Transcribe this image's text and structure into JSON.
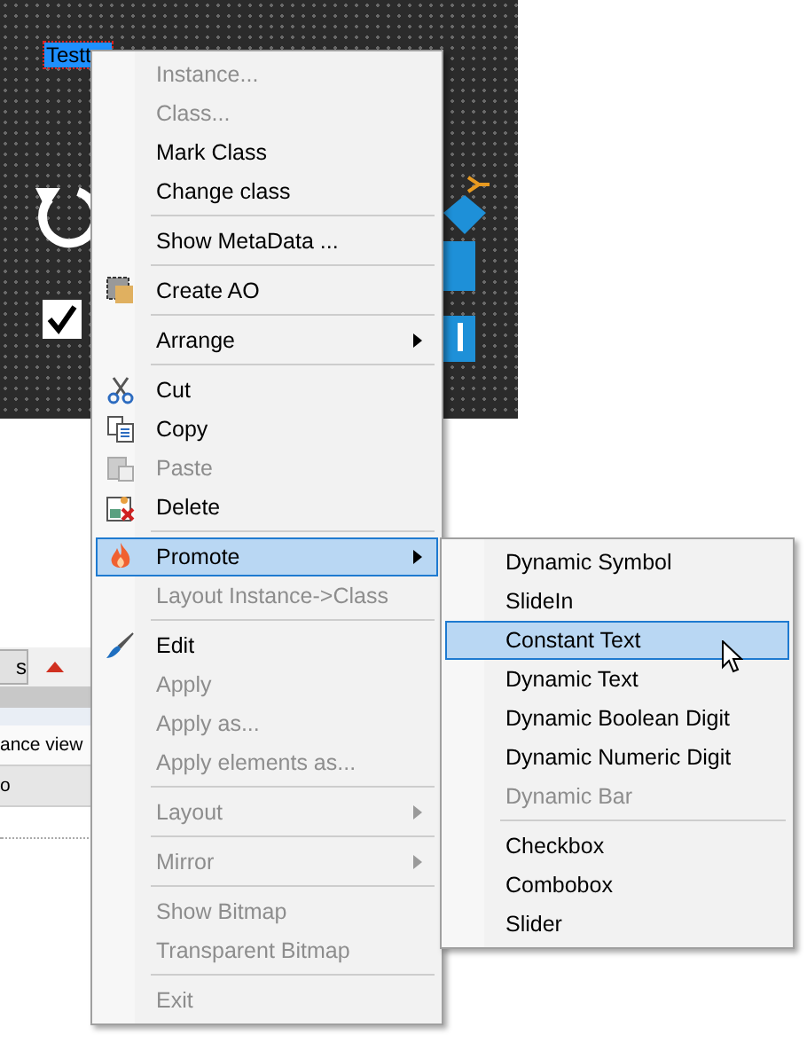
{
  "canvas": {
    "selected_label": "Testt"
  },
  "bottom_panel": {
    "toolbar_button": "s",
    "rows": [
      "ance view",
      "o"
    ]
  },
  "context_menu": {
    "items": [
      {
        "kind": "item",
        "label": "Instance...",
        "disabled": true,
        "submenu": false,
        "selected": false
      },
      {
        "kind": "item",
        "label": "Class...",
        "disabled": true,
        "submenu": false,
        "selected": false
      },
      {
        "kind": "item",
        "label": "Mark Class",
        "disabled": false,
        "submenu": false,
        "selected": false
      },
      {
        "kind": "item",
        "label": "Change class",
        "disabled": false,
        "submenu": false,
        "selected": false
      },
      {
        "kind": "separator"
      },
      {
        "kind": "item",
        "label": "Show MetaData ...",
        "disabled": false,
        "submenu": false,
        "selected": false
      },
      {
        "kind": "separator"
      },
      {
        "kind": "item",
        "label": "Create AO",
        "disabled": false,
        "submenu": false,
        "selected": false
      },
      {
        "kind": "separator"
      },
      {
        "kind": "item",
        "label": "Arrange",
        "disabled": false,
        "submenu": true,
        "selected": false
      },
      {
        "kind": "separator"
      },
      {
        "kind": "item",
        "label": "Cut",
        "disabled": false,
        "submenu": false,
        "selected": false
      },
      {
        "kind": "item",
        "label": "Copy",
        "disabled": false,
        "submenu": false,
        "selected": false
      },
      {
        "kind": "item",
        "label": "Paste",
        "disabled": true,
        "submenu": false,
        "selected": false
      },
      {
        "kind": "item",
        "label": "Delete",
        "disabled": false,
        "submenu": false,
        "selected": false
      },
      {
        "kind": "separator"
      },
      {
        "kind": "item",
        "label": "Promote",
        "disabled": false,
        "submenu": true,
        "selected": true
      },
      {
        "kind": "item",
        "label": "Layout Instance->Class",
        "disabled": true,
        "submenu": false,
        "selected": false
      },
      {
        "kind": "separator"
      },
      {
        "kind": "item",
        "label": "Edit",
        "disabled": false,
        "submenu": false,
        "selected": false
      },
      {
        "kind": "item",
        "label": "Apply",
        "disabled": true,
        "submenu": false,
        "selected": false
      },
      {
        "kind": "item",
        "label": "Apply as...",
        "disabled": true,
        "submenu": false,
        "selected": false
      },
      {
        "kind": "item",
        "label": "Apply elements as...",
        "disabled": true,
        "submenu": false,
        "selected": false
      },
      {
        "kind": "separator"
      },
      {
        "kind": "item",
        "label": "Layout",
        "disabled": true,
        "submenu": true,
        "selected": false
      },
      {
        "kind": "separator"
      },
      {
        "kind": "item",
        "label": "Mirror",
        "disabled": true,
        "submenu": true,
        "selected": false
      },
      {
        "kind": "separator"
      },
      {
        "kind": "item",
        "label": "Show Bitmap",
        "disabled": true,
        "submenu": false,
        "selected": false
      },
      {
        "kind": "item",
        "label": "Transparent Bitmap",
        "disabled": true,
        "submenu": false,
        "selected": false
      },
      {
        "kind": "separator"
      },
      {
        "kind": "item",
        "label": "Exit",
        "disabled": true,
        "submenu": false,
        "selected": false
      }
    ]
  },
  "submenu": {
    "items": [
      {
        "kind": "item",
        "label": "Dynamic Symbol",
        "disabled": false,
        "selected": false
      },
      {
        "kind": "item",
        "label": "SlideIn",
        "disabled": false,
        "selected": false
      },
      {
        "kind": "item",
        "label": "Constant Text",
        "disabled": false,
        "selected": true
      },
      {
        "kind": "item",
        "label": "Dynamic Text",
        "disabled": false,
        "selected": false
      },
      {
        "kind": "item",
        "label": "Dynamic Boolean Digit",
        "disabled": false,
        "selected": false
      },
      {
        "kind": "item",
        "label": "Dynamic Numeric Digit",
        "disabled": false,
        "selected": false
      },
      {
        "kind": "item",
        "label": "Dynamic Bar",
        "disabled": true,
        "selected": false
      },
      {
        "kind": "separator"
      },
      {
        "kind": "item",
        "label": "Checkbox",
        "disabled": false,
        "selected": false
      },
      {
        "kind": "item",
        "label": "Combobox",
        "disabled": false,
        "selected": false
      },
      {
        "kind": "item",
        "label": "Slider",
        "disabled": false,
        "selected": false
      }
    ]
  }
}
